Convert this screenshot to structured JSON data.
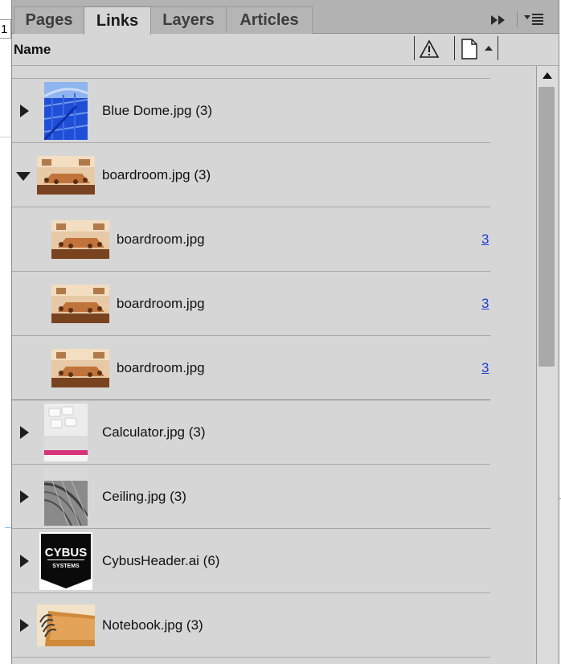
{
  "document": {
    "field_text": "1"
  },
  "tabs": [
    {
      "id": "pages",
      "label": "Pages"
    },
    {
      "id": "links",
      "label": "Links",
      "active": true
    },
    {
      "id": "layers",
      "label": "Layers"
    },
    {
      "id": "articles",
      "label": "Articles"
    }
  ],
  "toolbar": {
    "collapse_icon": "double-chevron-right-icon",
    "menu_icon": "panel-menu-icon"
  },
  "header": {
    "name_label": "Name",
    "status_icon": "warning-icon",
    "page_icon": "page-icon",
    "sort": "ascending"
  },
  "links": [
    {
      "name": "Blue Dome.jpg (3)",
      "type": "parent",
      "expanded": false,
      "thumb": "blue-dome"
    },
    {
      "name": "boardroom.jpg (3)",
      "type": "parent",
      "expanded": true,
      "thumb": "boardroom"
    },
    {
      "name": "boardroom.jpg",
      "type": "child",
      "page": "3",
      "thumb": "boardroom"
    },
    {
      "name": "boardroom.jpg",
      "type": "child",
      "page": "3",
      "thumb": "boardroom"
    },
    {
      "name": "boardroom.jpg",
      "type": "child",
      "page": "3",
      "thumb": "boardroom"
    },
    {
      "name": "Calculator.jpg (3)",
      "type": "parent",
      "expanded": false,
      "thumb": "calculator"
    },
    {
      "name": "Ceiling.jpg (3)",
      "type": "parent",
      "expanded": false,
      "thumb": "ceiling"
    },
    {
      "name": "CybusHeader.ai (6)",
      "type": "parent",
      "expanded": false,
      "thumb": "cybus"
    },
    {
      "name": "Notebook.jpg (3)",
      "type": "parent",
      "expanded": false,
      "thumb": "notebook"
    }
  ],
  "cybus_logo": {
    "line1": "CYBUS",
    "line2": "SYSTEMS"
  },
  "colors": {
    "panel_bg": "#d6d6d6",
    "tab_bar": "#b2b2b2",
    "link": "#1d3fd6"
  }
}
